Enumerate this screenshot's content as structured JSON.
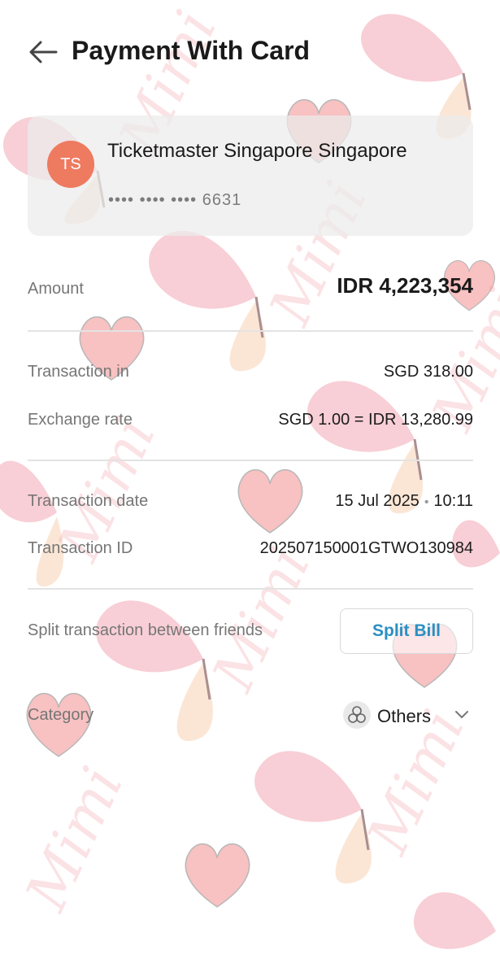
{
  "header": {
    "title": "Payment With Card",
    "back_icon": "arrow-left-icon"
  },
  "merchant": {
    "initials": "TS",
    "avatar_color": "#ee7a60",
    "name": "Ticketmaster Singapore Singapore",
    "card_number": "•••• •••• •••• 6631"
  },
  "amount": {
    "label": "Amount",
    "value": "IDR 4,223,354"
  },
  "transaction_currency": {
    "label": "Transaction in",
    "value": "SGD 318.00"
  },
  "exchange_rate": {
    "label": "Exchange rate",
    "value": "SGD 1.00 = IDR 13,280.99"
  },
  "transaction_date": {
    "label": "Transaction date",
    "date": "15 Jul 2025",
    "separator": "•",
    "time": "10:11"
  },
  "transaction_id": {
    "label": "Transaction ID",
    "value": "202507150001GTWO130984"
  },
  "split": {
    "label": "Split transaction between friends",
    "button_label": "Split Bill",
    "accent_color": "#2b8fc2"
  },
  "category": {
    "label": "Category",
    "value": "Others",
    "icon": "category-circles-icon",
    "chevron": "chevron-down-icon"
  },
  "watermark": {
    "text": "Mimi"
  }
}
